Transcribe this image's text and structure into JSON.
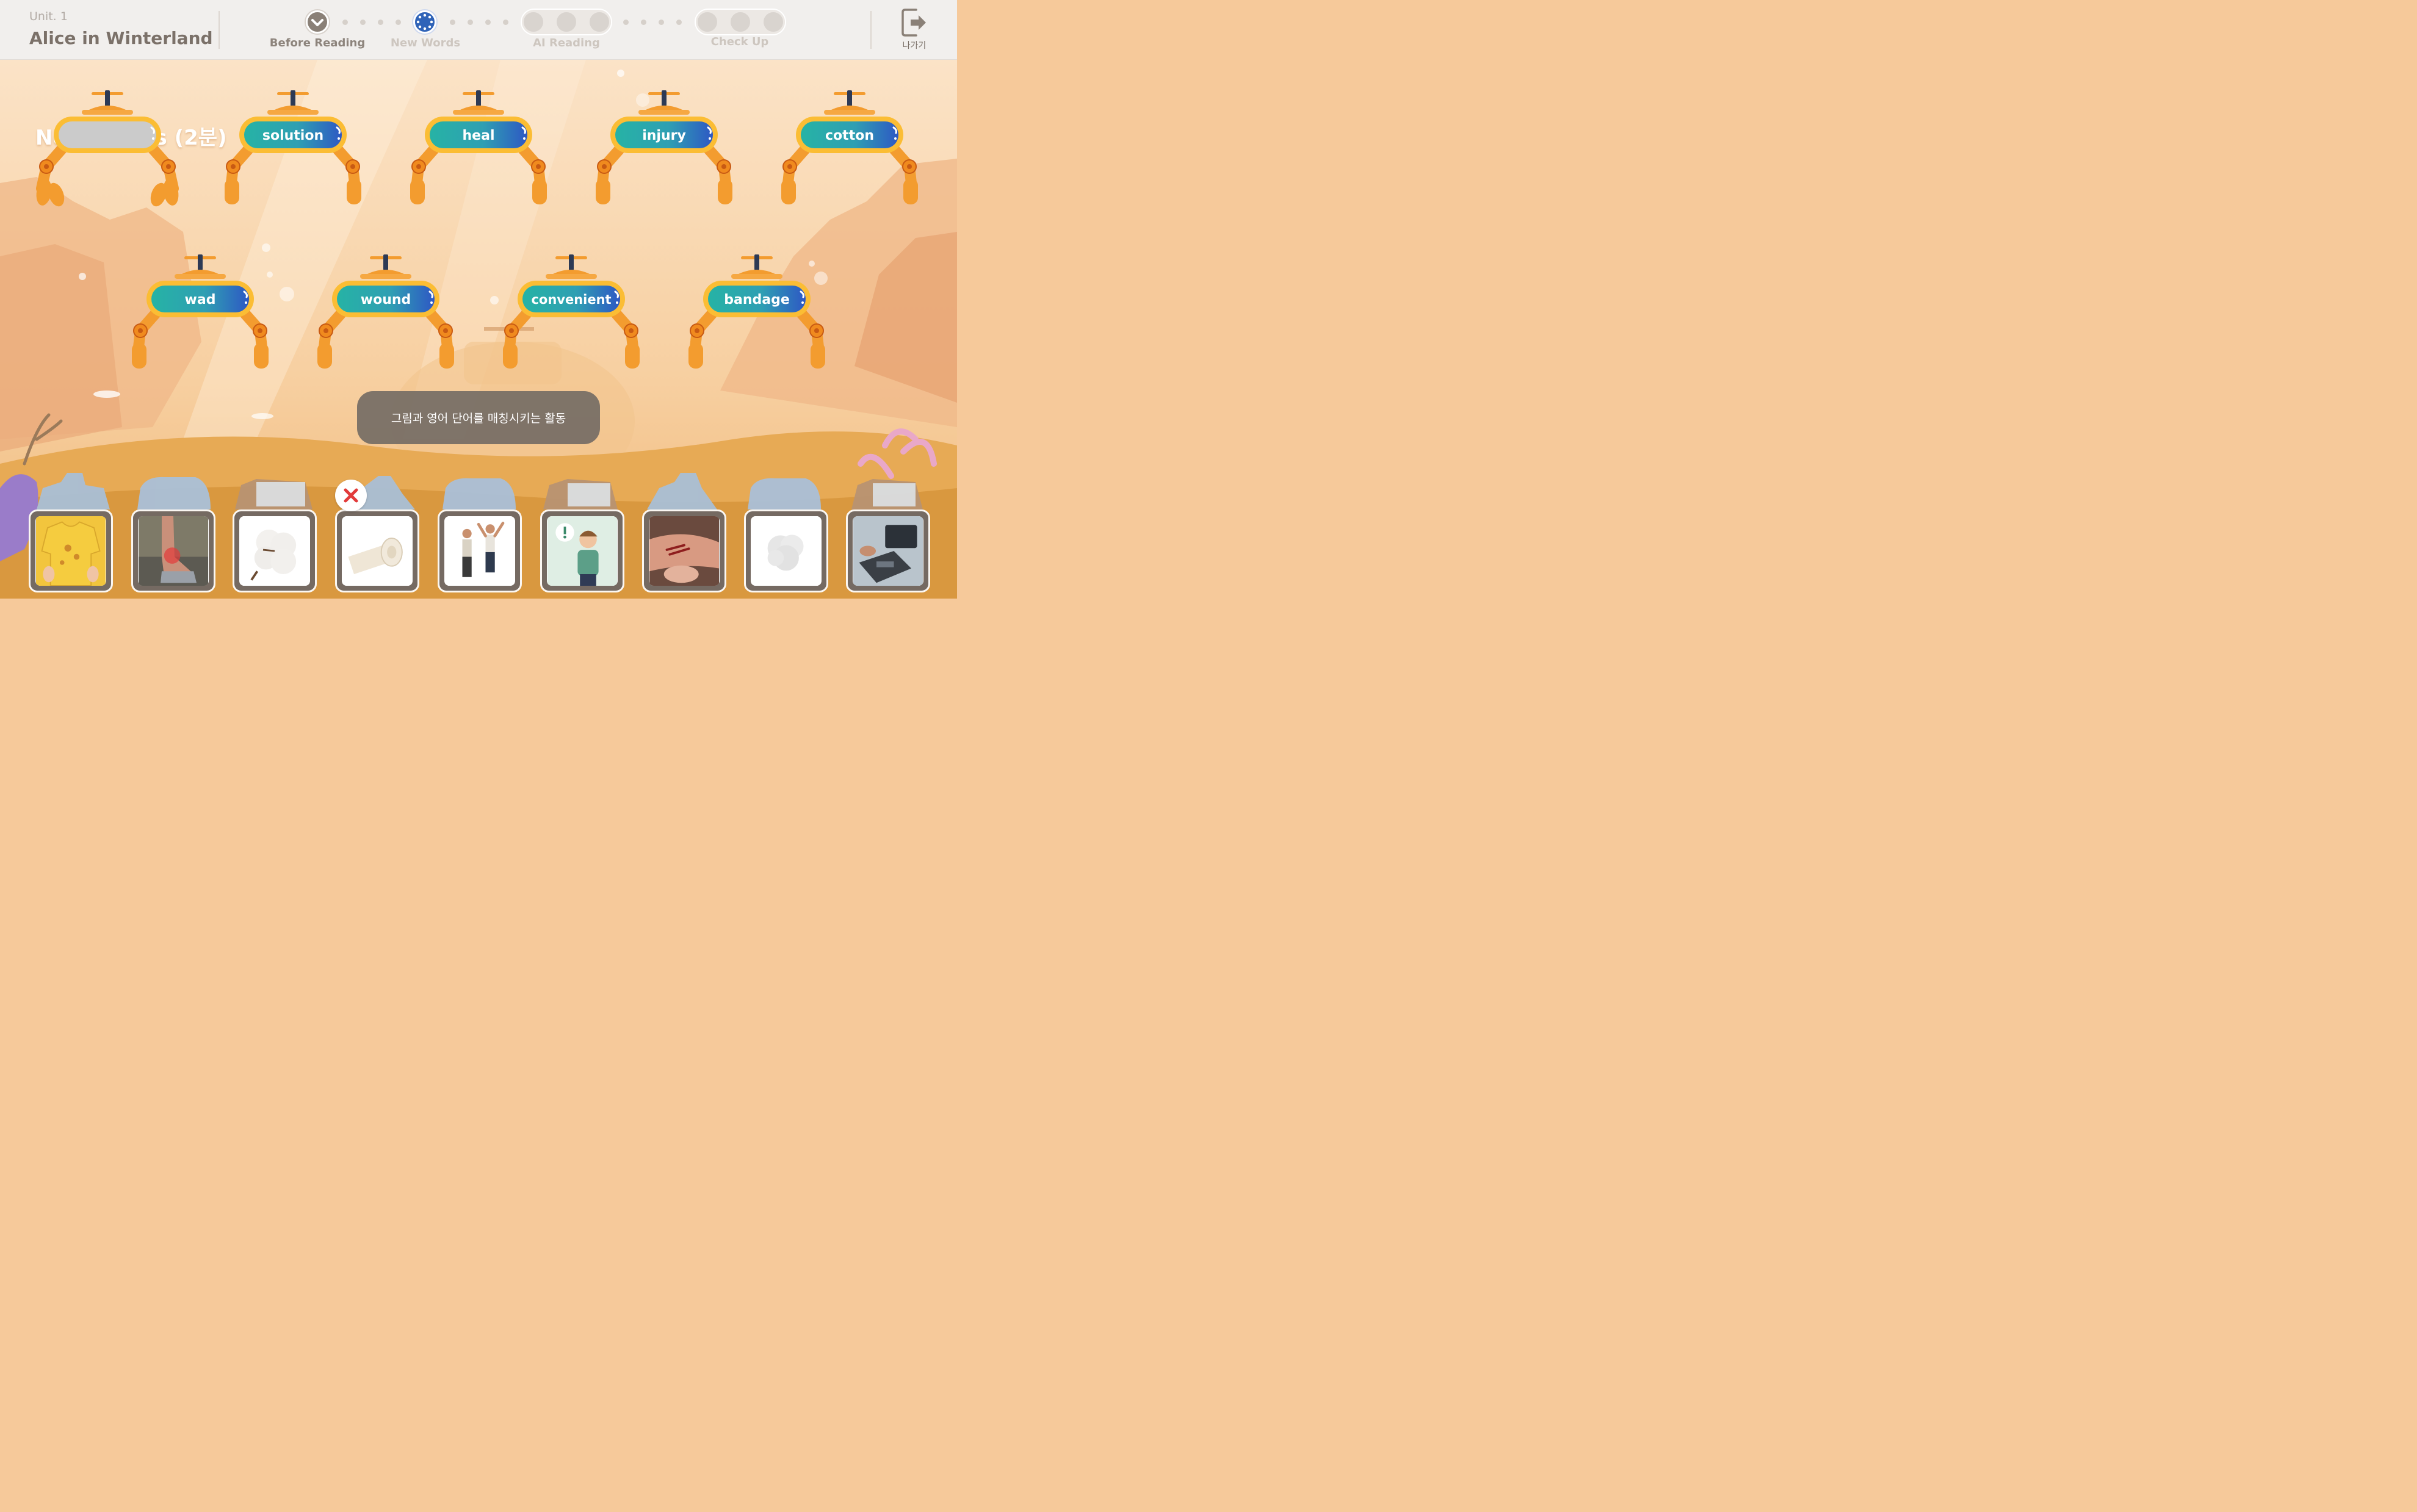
{
  "header": {
    "unit_label": "Unit. 1",
    "title": "Alice in Winterland",
    "steps": [
      {
        "label": "Before Reading",
        "state": "done"
      },
      {
        "label": "New Words",
        "state": "current"
      },
      {
        "label": "AI Reading",
        "state": "todo"
      },
      {
        "label": "Check Up",
        "state": "todo"
      }
    ],
    "exit_label": "나가기"
  },
  "activity": {
    "title": "New Words (2분)",
    "claws": [
      {
        "word": "",
        "empty": true
      },
      {
        "word": "solution"
      },
      {
        "word": "heal"
      },
      {
        "word": "injury"
      },
      {
        "word": "cotton"
      },
      {
        "word": "wad"
      },
      {
        "word": "wound"
      },
      {
        "word": "convenient"
      },
      {
        "word": "bandage"
      }
    ],
    "tooltip": "그림과 영어 단어를 매칭시키는 활동",
    "cards": [
      {
        "icon": "stained-shirt-picture"
      },
      {
        "icon": "ankle-injury-picture"
      },
      {
        "icon": "cotton-boll-picture"
      },
      {
        "icon": "bandage-roll-picture",
        "marked_wrong": true
      },
      {
        "icon": "cheering-men-picture"
      },
      {
        "icon": "idea-man-picture"
      },
      {
        "icon": "wounded-arm-picture"
      },
      {
        "icon": "cotton-wad-picture"
      },
      {
        "icon": "payment-terminal-picture"
      }
    ]
  },
  "colors": {
    "accent_blue": "#2f63b8",
    "word_teal": "#26b3a5",
    "word_blue": "#2e58c4",
    "claw_orange": "#f39c2f",
    "card_frame": "#756a62"
  }
}
